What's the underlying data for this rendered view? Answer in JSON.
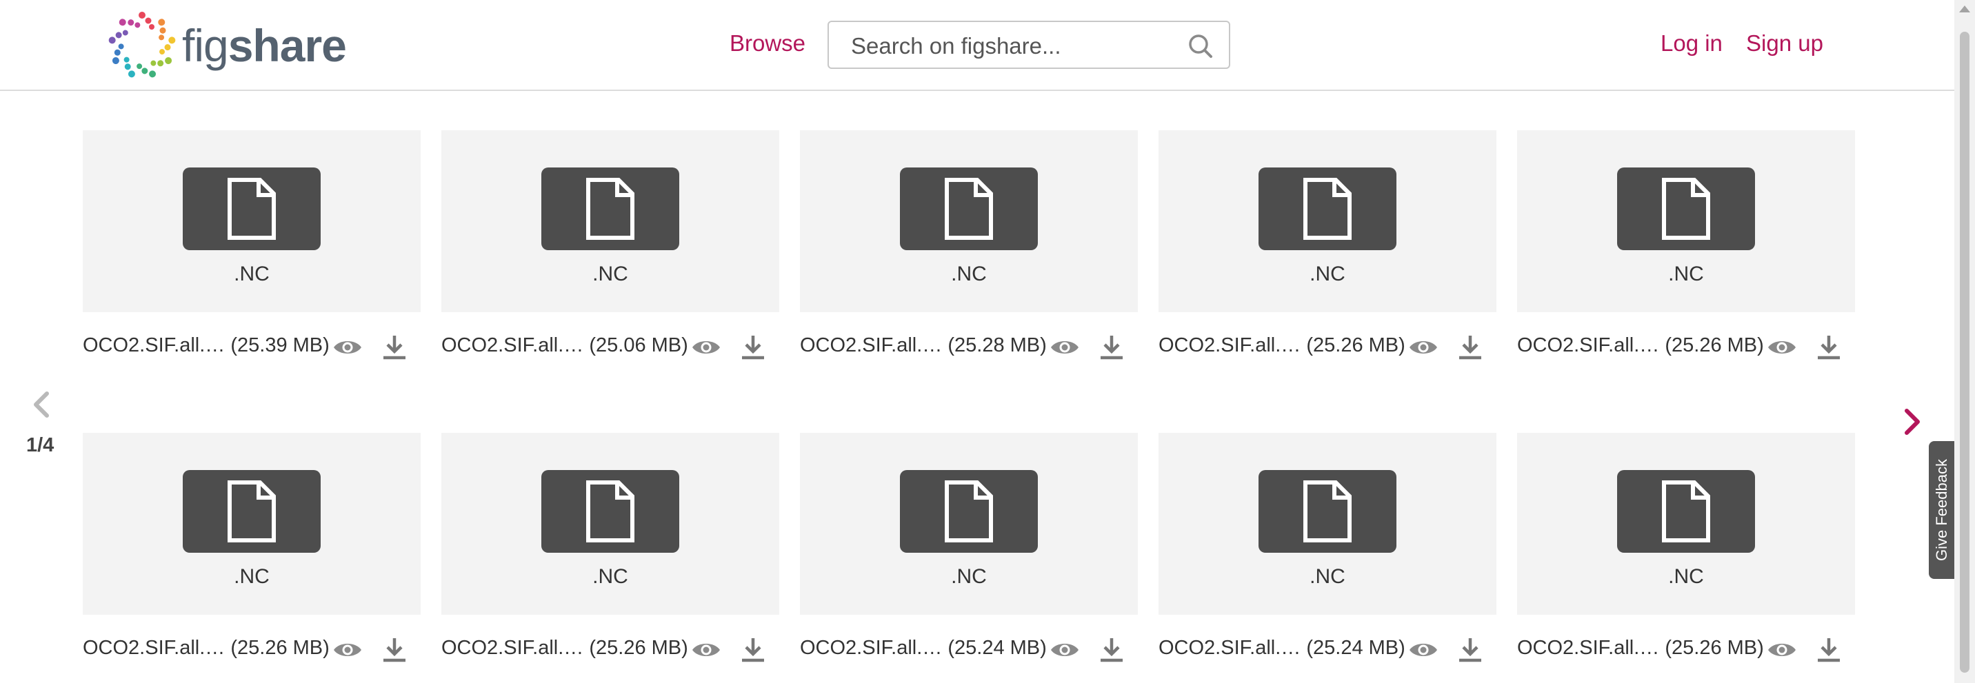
{
  "header": {
    "logo_text_light": "fig",
    "logo_text_bold": "share",
    "browse_label": "Browse",
    "search_placeholder": "Search on figshare...",
    "login_label": "Log in",
    "signup_label": "Sign up"
  },
  "pager": {
    "indicator": "1/4"
  },
  "files": [
    {
      "ext": ".NC",
      "name": "OCO2.SIF.all.…",
      "size": "(25.39 MB)"
    },
    {
      "ext": ".NC",
      "name": "OCO2.SIF.all.…",
      "size": "(25.06 MB)"
    },
    {
      "ext": ".NC",
      "name": "OCO2.SIF.all.…",
      "size": "(25.28 MB)"
    },
    {
      "ext": ".NC",
      "name": "OCO2.SIF.all.…",
      "size": "(25.26 MB)"
    },
    {
      "ext": ".NC",
      "name": "OCO2.SIF.all.…",
      "size": "(25.26 MB)"
    },
    {
      "ext": ".NC",
      "name": "OCO2.SIF.all.…",
      "size": "(25.26 MB)"
    },
    {
      "ext": ".NC",
      "name": "OCO2.SIF.all.…",
      "size": "(25.26 MB)"
    },
    {
      "ext": ".NC",
      "name": "OCO2.SIF.all.…",
      "size": "(25.24 MB)"
    },
    {
      "ext": ".NC",
      "name": "OCO2.SIF.all.…",
      "size": "(25.24 MB)"
    },
    {
      "ext": ".NC",
      "name": "OCO2.SIF.all.…",
      "size": "(25.26 MB)"
    }
  ],
  "feedback_label": "Give Feedback",
  "colors": {
    "accent": "#b3165a",
    "icon_tile": "#4d4d4d",
    "thumb_bg": "#f3f3f3"
  }
}
